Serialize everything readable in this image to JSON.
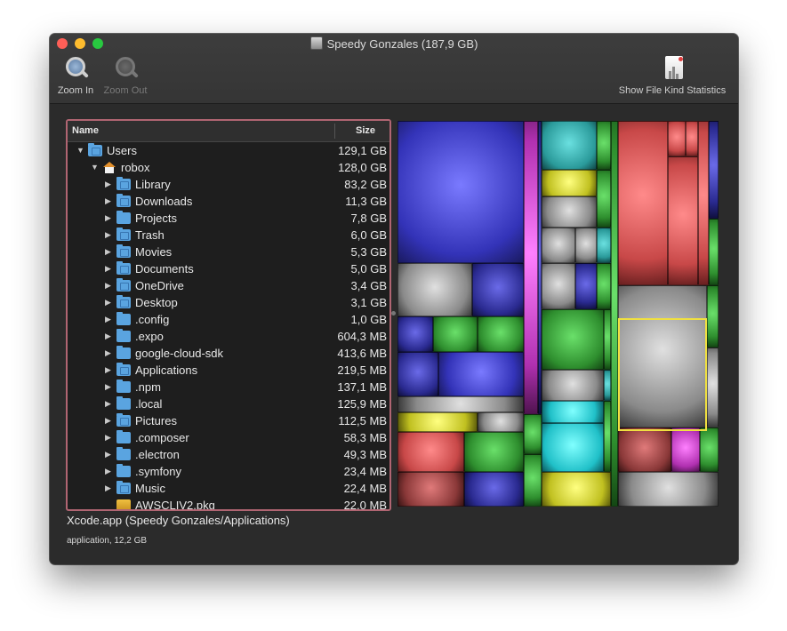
{
  "window": {
    "title": "Speedy Gonzales (187,9 GB)"
  },
  "toolbar": {
    "zoom_in_label": "Zoom In",
    "zoom_out_label": "Zoom Out",
    "file_kind_stats_label": "Show File Kind Statistics"
  },
  "file_list": {
    "columns": {
      "name": "Name",
      "size": "Size"
    },
    "rows": [
      {
        "name": "Users",
        "size": "129,1 GB",
        "depth": 0,
        "expanded": true,
        "icon": "users-folder-icon"
      },
      {
        "name": "robox",
        "size": "128,0 GB",
        "depth": 1,
        "expanded": true,
        "icon": "home-icon"
      },
      {
        "name": "Library",
        "size": "83,2 GB",
        "depth": 2,
        "expanded": false,
        "icon": "library-folder-icon"
      },
      {
        "name": "Downloads",
        "size": "11,3 GB",
        "depth": 2,
        "expanded": false,
        "icon": "downloads-folder-icon"
      },
      {
        "name": "Projects",
        "size": "7,8 GB",
        "depth": 2,
        "expanded": false,
        "icon": "folder-icon"
      },
      {
        "name": "Trash",
        "size": "6,0 GB",
        "depth": 2,
        "expanded": false,
        "icon": "trash-folder-icon"
      },
      {
        "name": "Movies",
        "size": "5,3 GB",
        "depth": 2,
        "expanded": false,
        "icon": "movies-folder-icon"
      },
      {
        "name": "Documents",
        "size": "5,0 GB",
        "depth": 2,
        "expanded": false,
        "icon": "documents-folder-icon"
      },
      {
        "name": "OneDrive",
        "size": "3,4 GB",
        "depth": 2,
        "expanded": false,
        "icon": "onedrive-folder-icon"
      },
      {
        "name": "Desktop",
        "size": "3,1 GB",
        "depth": 2,
        "expanded": false,
        "icon": "desktop-folder-icon"
      },
      {
        "name": ".config",
        "size": "1,0 GB",
        "depth": 2,
        "expanded": false,
        "icon": "folder-icon"
      },
      {
        "name": ".expo",
        "size": "604,3 MB",
        "depth": 2,
        "expanded": false,
        "icon": "folder-icon"
      },
      {
        "name": "google-cloud-sdk",
        "size": "413,6 MB",
        "depth": 2,
        "expanded": false,
        "icon": "folder-icon"
      },
      {
        "name": "Applications",
        "size": "219,5 MB",
        "depth": 2,
        "expanded": false,
        "icon": "applications-folder-icon"
      },
      {
        "name": ".npm",
        "size": "137,1 MB",
        "depth": 2,
        "expanded": false,
        "icon": "folder-icon"
      },
      {
        "name": ".local",
        "size": "125,9 MB",
        "depth": 2,
        "expanded": false,
        "icon": "folder-icon"
      },
      {
        "name": "Pictures",
        "size": "112,5 MB",
        "depth": 2,
        "expanded": false,
        "icon": "pictures-folder-icon"
      },
      {
        "name": ".composer",
        "size": "58,3 MB",
        "depth": 2,
        "expanded": false,
        "icon": "folder-icon"
      },
      {
        "name": ".electron",
        "size": "49,3 MB",
        "depth": 2,
        "expanded": false,
        "icon": "folder-icon"
      },
      {
        "name": ".symfony",
        "size": "23,4 MB",
        "depth": 2,
        "expanded": false,
        "icon": "folder-icon"
      },
      {
        "name": "Music",
        "size": "22,4 MB",
        "depth": 2,
        "expanded": false,
        "icon": "music-folder-icon"
      },
      {
        "name": "AWSCLIV2.pkg",
        "size": "22,0 MB",
        "depth": 2,
        "expanded": null,
        "icon": "package-icon"
      }
    ]
  },
  "status": {
    "selected_title": "Xcode.app (Speedy Gonzales/Applications)",
    "selected_details": "application, 12,2 GB"
  },
  "colors": {
    "selection_border": "#b06572",
    "highlight_border": "#f0e040",
    "folder_blue": "#5aa4e0"
  }
}
